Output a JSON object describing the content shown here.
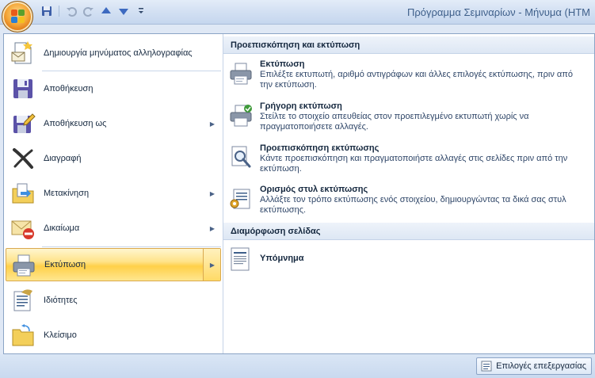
{
  "window": {
    "title": "Πρόγραμμα Σεμιναρίων - Μήνυμα (HTM"
  },
  "quick_access": [
    {
      "icon": "save-icon"
    },
    {
      "icon": "undo-icon"
    },
    {
      "icon": "redo-icon"
    },
    {
      "icon": "previous-item-icon"
    },
    {
      "icon": "next-item-icon"
    },
    {
      "icon": "customize-dropdown-icon"
    }
  ],
  "left_menu": [
    {
      "label": "Δημιουργία μηνύματος αλληλογραφίας",
      "icon": "new-mail-icon",
      "arrow": false
    },
    {
      "label": "Αποθήκευση",
      "icon": "save-icon",
      "arrow": false
    },
    {
      "label": "Αποθήκευση ως",
      "icon": "save-as-icon",
      "arrow": true
    },
    {
      "label": "Διαγραφή",
      "icon": "delete-icon",
      "arrow": false
    },
    {
      "label": "Μετακίνηση",
      "icon": "move-icon",
      "arrow": true
    },
    {
      "label": "Δικαίωμα",
      "icon": "permission-icon",
      "arrow": true
    },
    {
      "label": "Εκτύπωση",
      "icon": "print-icon",
      "arrow": true,
      "active": true
    },
    {
      "label": "Ιδιότητες",
      "icon": "properties-icon",
      "arrow": false
    },
    {
      "label": "Κλείσιμο",
      "icon": "close-folder-icon",
      "arrow": false
    }
  ],
  "right_panel": {
    "section1_title": "Προεπισκόπηση και εκτύπωση",
    "items": [
      {
        "title": "Εκτύπωση",
        "desc": "Επιλέξτε εκτυπωτή, αριθμό αντιγράφων και άλλες επιλογές εκτύπωσης, πριν από την εκτύπωση.",
        "icon": "printer-icon"
      },
      {
        "title": "Γρήγορη εκτύπωση",
        "desc": "Στείλτε το στοιχείο απευθείας στον προεπιλεγμένο εκτυπωτή χωρίς να πραγματοποιήσετε αλλαγές.",
        "icon": "quick-print-icon"
      },
      {
        "title": "Προεπισκόπηση εκτύπωσης",
        "desc": "Κάντε προεπισκόπηση και πραγματοποιήστε αλλαγές στις σελίδες πριν από την εκτύπωση.",
        "icon": "print-preview-icon"
      },
      {
        "title": "Ορισμός στυλ εκτύπωσης",
        "desc": "Αλλάξτε τον τρόπο εκτύπωσης ενός στοιχείου, δημιουργώντας τα δικά σας στυλ εκτύπωσης.",
        "icon": "print-style-icon"
      }
    ],
    "section2_title": "Διαμόρφωση σελίδας",
    "memo": {
      "title": "Υπόμνημα",
      "icon": "memo-style-icon"
    }
  },
  "bottom": {
    "options_label": "Επιλογές επεξεργασίας",
    "options_icon": "editor-options-icon"
  },
  "colors": {
    "active_item_bg": "#ffd049",
    "panel_border": "#8ba4c6",
    "title_text": "#3e5f8a"
  }
}
